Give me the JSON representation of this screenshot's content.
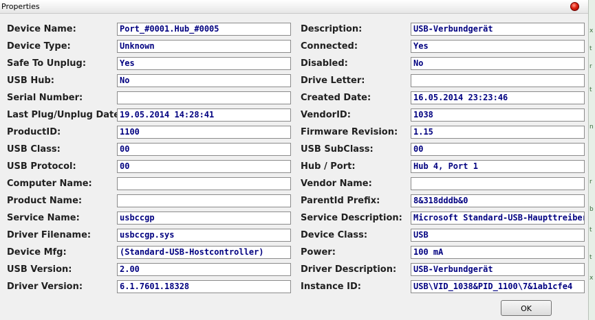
{
  "window": {
    "title": "Properties"
  },
  "left": [
    {
      "label": "Device Name:",
      "value": "Port_#0001.Hub_#0005"
    },
    {
      "label": "Device Type:",
      "value": "Unknown"
    },
    {
      "label": "Safe To Unplug:",
      "value": "Yes"
    },
    {
      "label": "USB Hub:",
      "value": "No"
    },
    {
      "label": "Serial Number:",
      "value": ""
    },
    {
      "label": "Last Plug/Unplug Date:",
      "value": "19.05.2014 14:28:41"
    },
    {
      "label": "ProductID:",
      "value": "1100"
    },
    {
      "label": "USB Class:",
      "value": "00"
    },
    {
      "label": "USB Protocol:",
      "value": "00"
    },
    {
      "label": "Computer Name:",
      "value": ""
    },
    {
      "label": "Product Name:",
      "value": ""
    },
    {
      "label": "Service Name:",
      "value": "usbccgp"
    },
    {
      "label": "Driver Filename:",
      "value": "usbccgp.sys"
    },
    {
      "label": "Device Mfg:",
      "value": "(Standard-USB-Hostcontroller)"
    },
    {
      "label": "USB Version:",
      "value": "2.00"
    },
    {
      "label": "Driver Version:",
      "value": "6.1.7601.18328"
    }
  ],
  "right": [
    {
      "label": "Description:",
      "value": "USB-Verbundgerät"
    },
    {
      "label": "Connected:",
      "value": "Yes"
    },
    {
      "label": "Disabled:",
      "value": "No"
    },
    {
      "label": "Drive Letter:",
      "value": ""
    },
    {
      "label": "Created Date:",
      "value": "16.05.2014 23:23:46"
    },
    {
      "label": "VendorID:",
      "value": "1038"
    },
    {
      "label": "Firmware Revision:",
      "value": "1.15"
    },
    {
      "label": "USB SubClass:",
      "value": "00"
    },
    {
      "label": "Hub / Port:",
      "value": "Hub 4, Port 1"
    },
    {
      "label": "Vendor Name:",
      "value": ""
    },
    {
      "label": "ParentId Prefix:",
      "value": "8&318dddb&0"
    },
    {
      "label": "Service Description:",
      "value": "Microsoft Standard-USB-Haupttreiber"
    },
    {
      "label": "Device Class:",
      "value": "USB"
    },
    {
      "label": "Power:",
      "value": "100 mA"
    },
    {
      "label": "Driver Description:",
      "value": "USB-Verbundgerät"
    },
    {
      "label": "Instance ID:",
      "value": "USB\\VID_1038&PID_1100\\7&1ab1cfe4"
    }
  ],
  "buttons": {
    "ok": "OK"
  },
  "colors": {
    "field_text": "#000080",
    "close_button": "#e02010"
  }
}
